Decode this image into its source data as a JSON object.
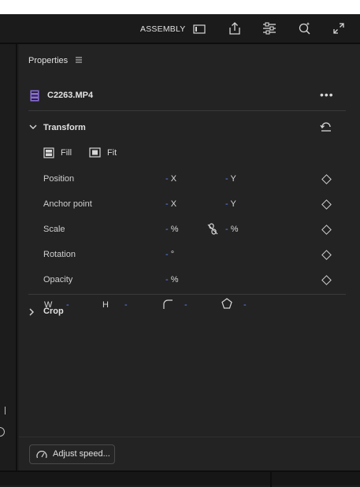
{
  "toolbar": {
    "workspace_label": "ASSEMBLY",
    "icons": [
      "layout-icon",
      "share-icon",
      "menu-settings-icon",
      "quality-search-icon",
      "fullscreen-icon"
    ]
  },
  "panel": {
    "title": "Properties",
    "clip_name": "C2263.MP4",
    "transform": {
      "title": "Transform",
      "fill_label": "Fill",
      "fit_label": "Fit",
      "rows": [
        {
          "label": "Position",
          "x_prefix": "-",
          "x_unit": "X",
          "y_prefix": "-",
          "y_unit": "Y"
        },
        {
          "label": "Anchor point",
          "x_prefix": "-",
          "x_unit": "X",
          "y_prefix": "-",
          "y_unit": "Y"
        },
        {
          "label": "Scale",
          "x_prefix": "-",
          "x_unit": "%",
          "y_prefix": "-",
          "y_unit": "%"
        },
        {
          "label": "Rotation",
          "x_prefix": "-",
          "x_unit": "°"
        },
        {
          "label": "Opacity",
          "x_prefix": "-",
          "x_unit": "%"
        }
      ]
    },
    "crop": {
      "title": "Crop",
      "w_label": "W",
      "w_value": "-",
      "h_label": "H",
      "h_value": "-",
      "corner_value": "-",
      "shape_value": "-"
    },
    "adjust_speed_label": "Adjust speed..."
  },
  "colors": {
    "accent_blue": "#5f86ff",
    "clip_icon_purple": "#8a6fd6"
  }
}
